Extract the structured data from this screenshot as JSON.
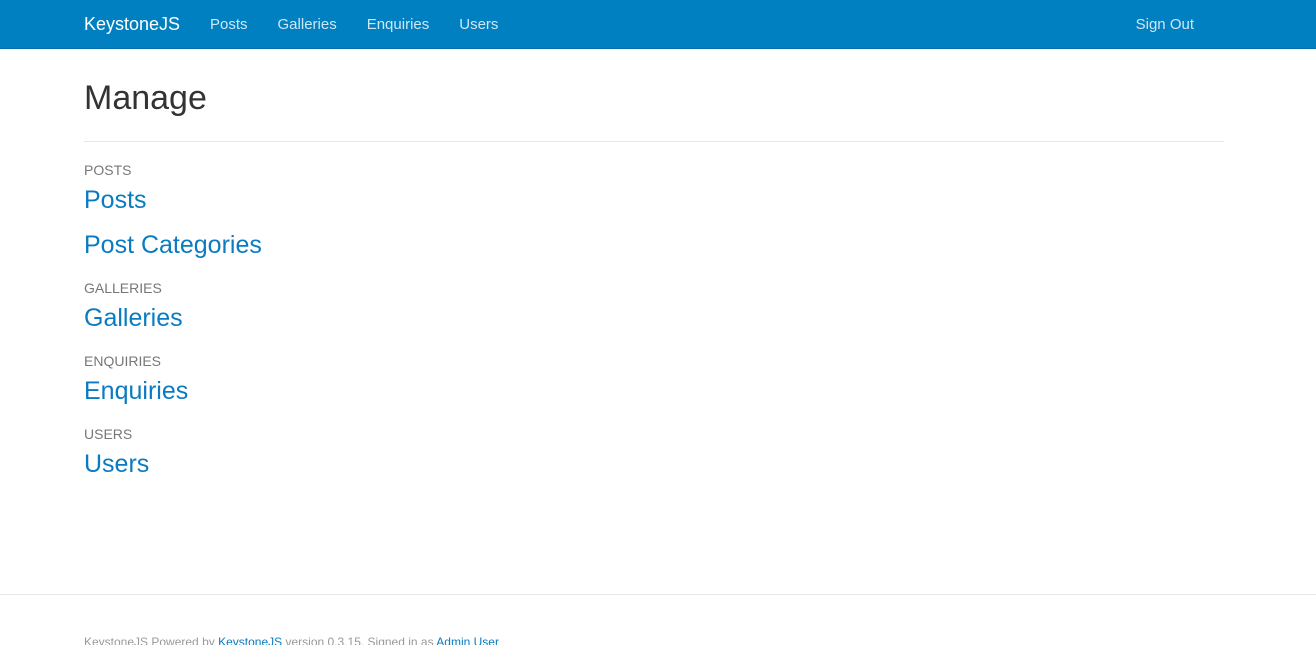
{
  "navbar": {
    "brand": "KeystoneJS",
    "links": [
      "Posts",
      "Galleries",
      "Enquiries",
      "Users"
    ],
    "sign_out": "Sign Out",
    "background": "#0080c0"
  },
  "main": {
    "title": "Manage",
    "sections": [
      {
        "heading": "POSTS",
        "items": [
          "Posts",
          "Post Categories"
        ]
      },
      {
        "heading": "GALLERIES",
        "items": [
          "Galleries"
        ]
      },
      {
        "heading": "ENQUIRIES",
        "items": [
          "Enquiries"
        ]
      },
      {
        "heading": "USERS",
        "items": [
          "Users"
        ]
      }
    ]
  },
  "footer": {
    "prefix": "KeystoneJS Powered by",
    "keystone_link": "KeystoneJS",
    "version_text": "version 0.3.15. Signed in as",
    "user_link": "Admin User",
    "link_color": "#0a7bc1"
  }
}
